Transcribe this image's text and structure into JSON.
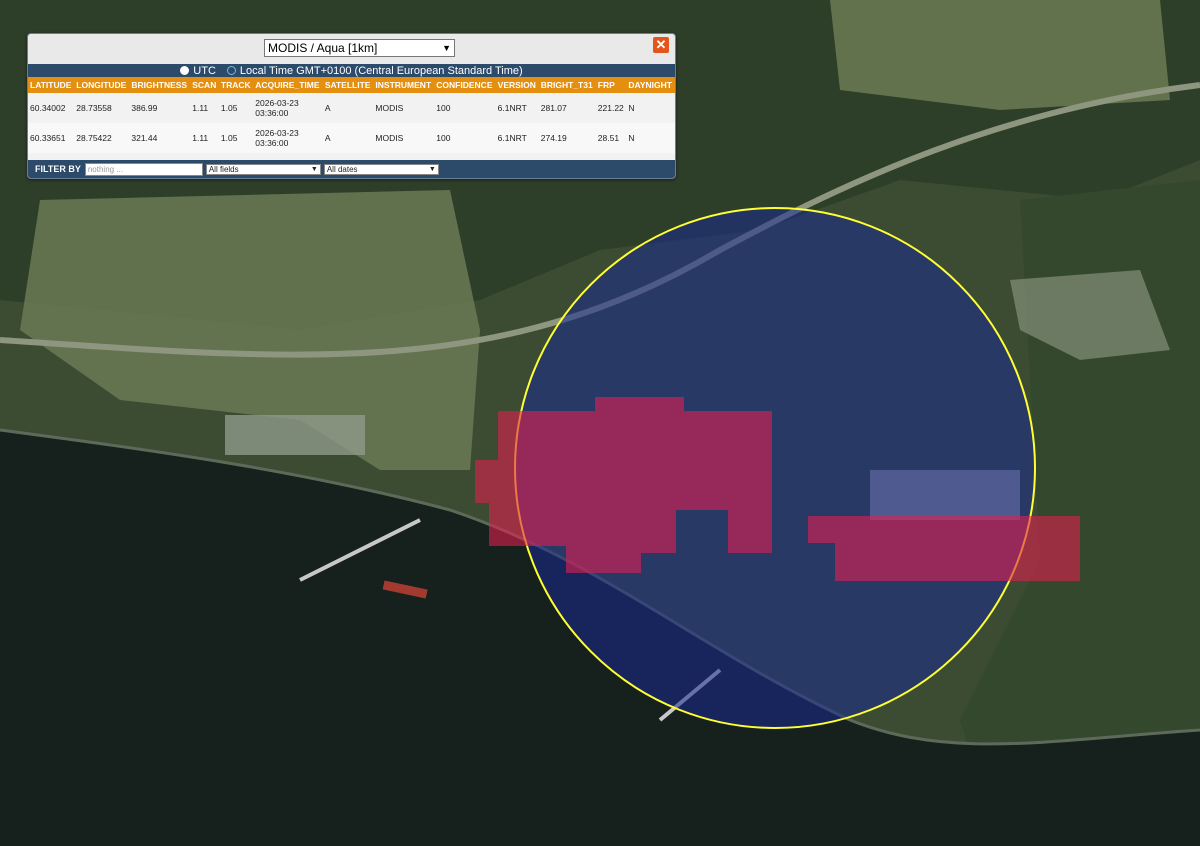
{
  "map": {
    "colors": {
      "water": "#16201d",
      "forest": "#2e3f2a",
      "field": "#6f7d5a",
      "highlight": "#e02050",
      "circle_stroke": "#ffff33",
      "circle_fill": "#1a2a90"
    },
    "icons": [
      "close-icon",
      "chevron-down-icon"
    ]
  },
  "panel": {
    "layer": "MODIS / Aqua [1km]",
    "close_label": "✕",
    "time": {
      "utc_label": "UTC",
      "local_label": "Local Time GMT+0100 (Central European Standard Time)"
    },
    "columns": [
      "LATITUDE",
      "LONGITUDE",
      "BRIGHTNESS",
      "SCAN",
      "TRACK",
      "ACQUIRE_TIME",
      "SATELLITE",
      "INSTRUMENT",
      "CONFIDENCE",
      "VERSION",
      "BRIGHT_T31",
      "FRP",
      "DAYNIGHT"
    ],
    "rows": [
      {
        "latitude": "60.34002",
        "longitude": "28.73558",
        "brightness": "386.99",
        "scan": "1.11",
        "track": "1.05",
        "date": "2026-03-23",
        "time": "03:36:00",
        "satellite": "A",
        "instrument": "MODIS",
        "confidence": "100",
        "version": "6.1NRT",
        "bright_t31": "281.07",
        "frp": "221.22",
        "daynight": "N"
      },
      {
        "latitude": "60.33651",
        "longitude": "28.75422",
        "brightness": "321.44",
        "scan": "1.11",
        "track": "1.05",
        "date": "2026-03-23",
        "time": "03:36:00",
        "satellite": "A",
        "instrument": "MODIS",
        "confidence": "100",
        "version": "6.1NRT",
        "bright_t31": "274.19",
        "frp": "28.51",
        "daynight": "N"
      }
    ],
    "filter": {
      "label": "FILTER BY",
      "placeholder": "nothing ...",
      "fields": "All fields",
      "dates": "All dates"
    }
  }
}
